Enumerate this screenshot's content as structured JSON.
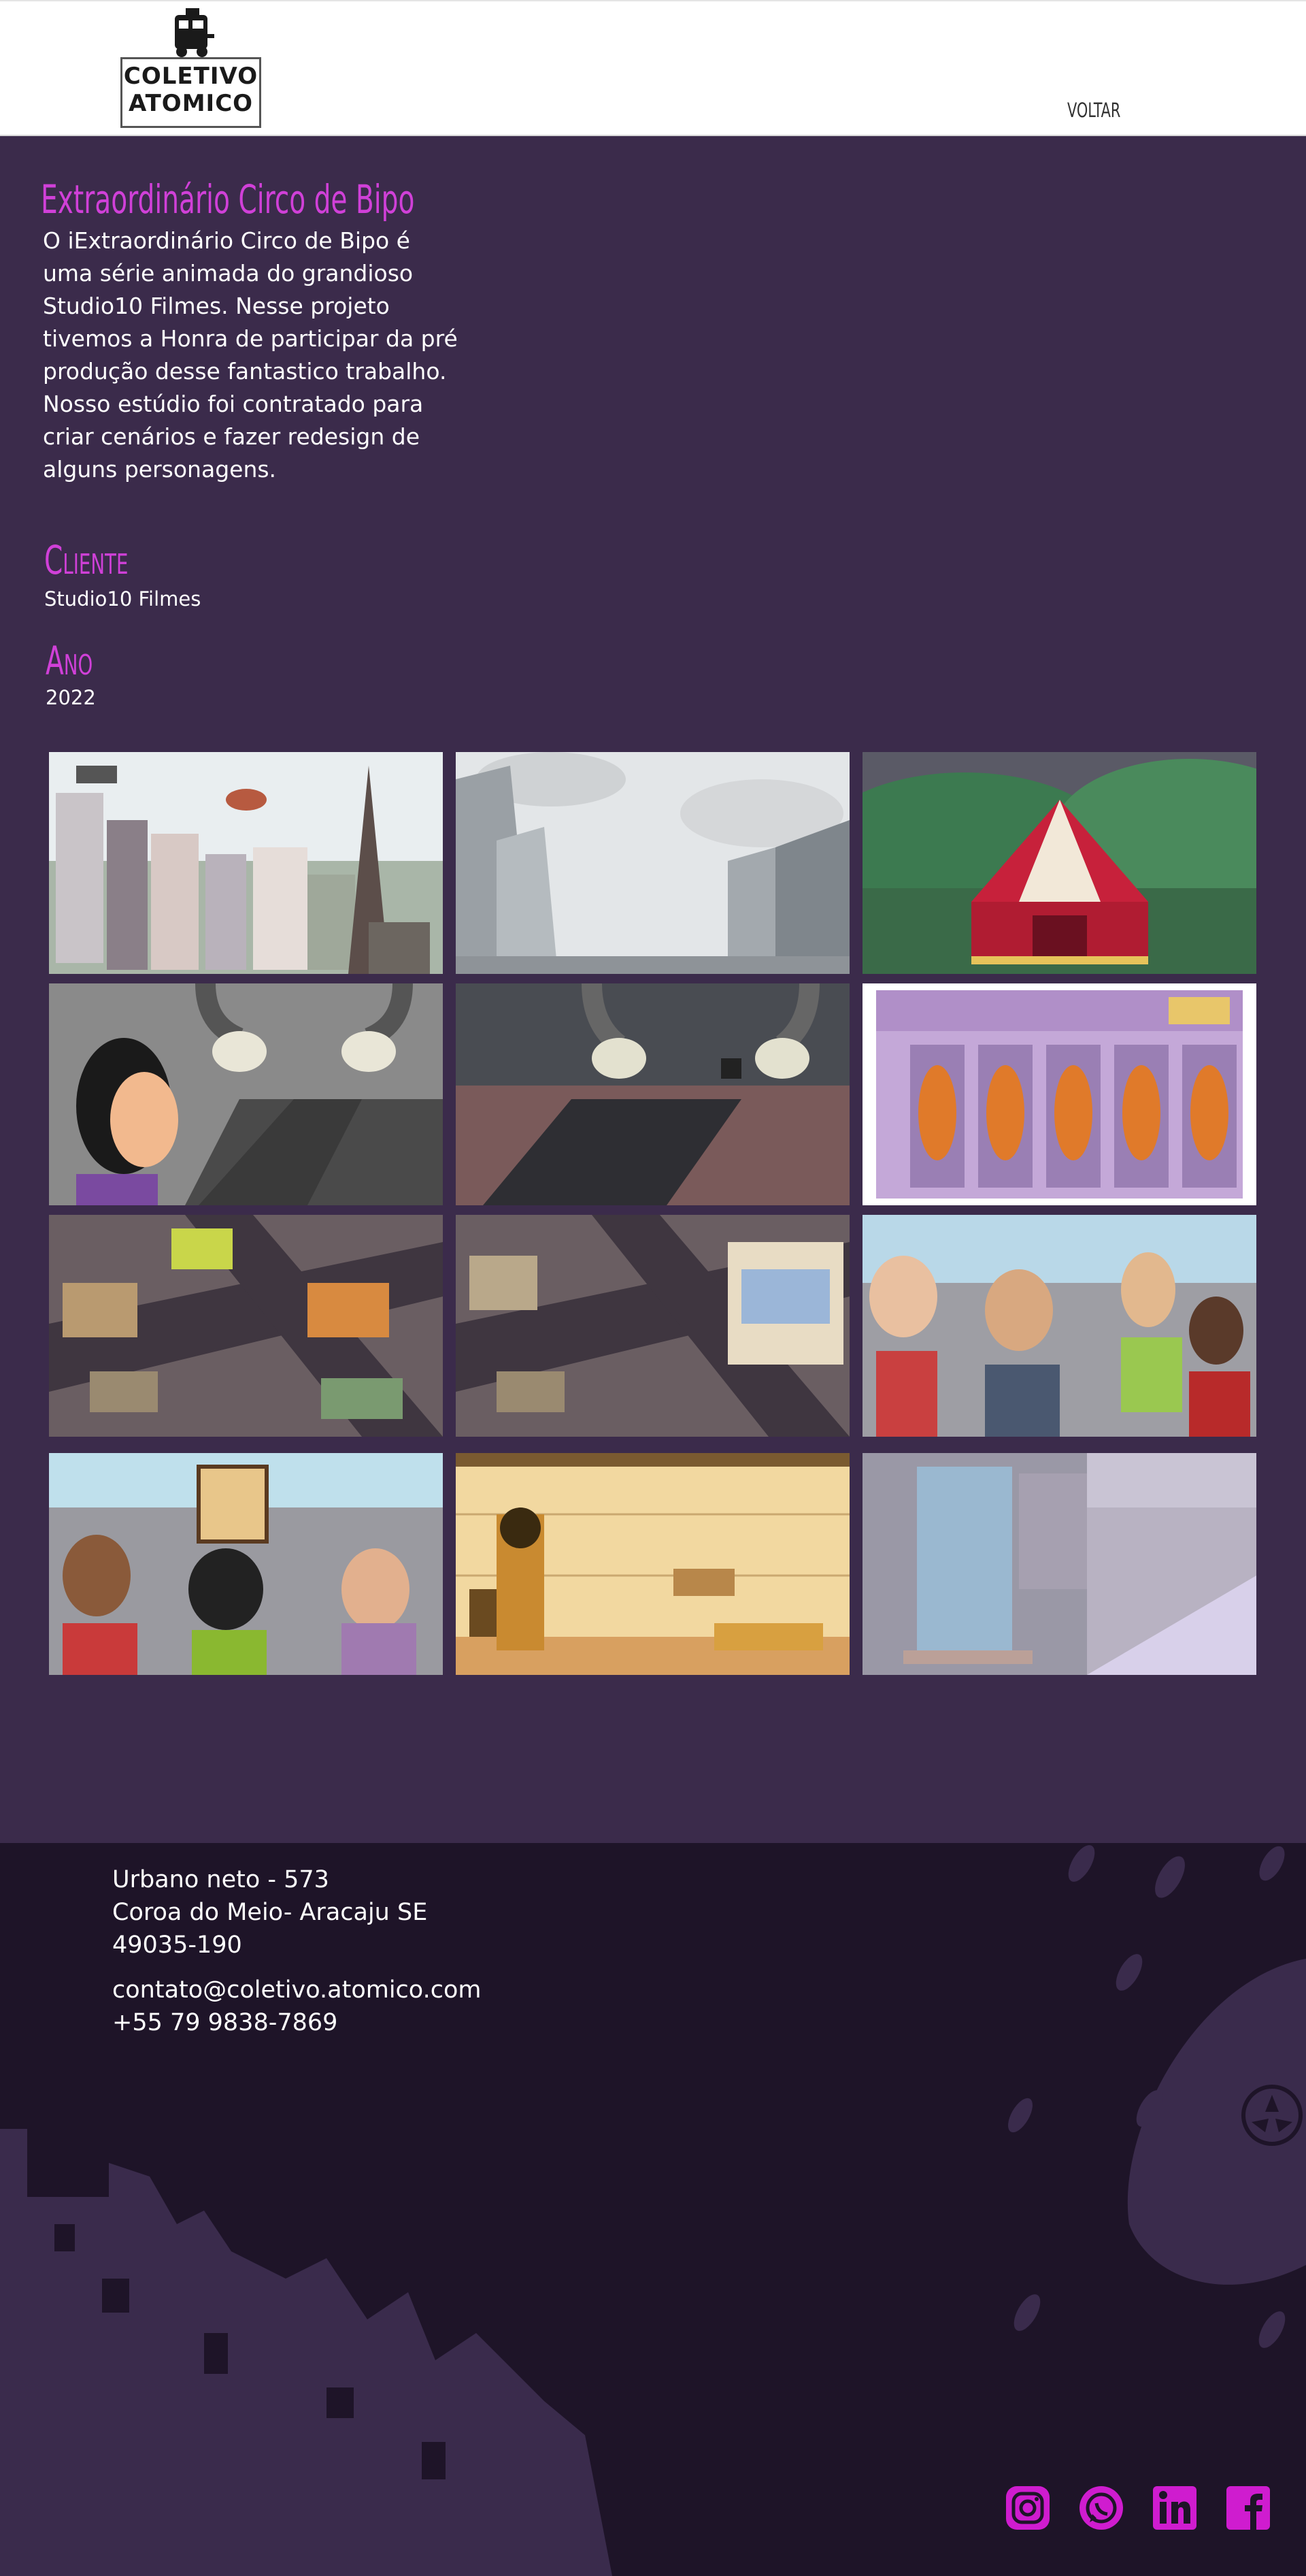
{
  "header": {
    "logo_text": "COLETIVO ATOMICO",
    "back_label": "VOLTAR"
  },
  "project": {
    "title": "Extraordinário Circo de Bipo",
    "description": [
      "O iExtraordinário Circo de Bipo é uma série animada do grandioso Studio10 Filmes. Nesse projeto tivemos a Honra de participar da pré produção desse fantastico trabalho.",
      "Nosso estúdio foi contratado para criar cenários e fazer redesign de alguns personagens."
    ],
    "client_label": "Cliente",
    "client_value": "Studio10 Filmes",
    "year_label": "Ano",
    "year_value": "2022"
  },
  "gallery": {
    "images": [
      "city-antenna-scene",
      "skyscrapers-clouds-scene",
      "circus-tent-scene",
      "character-robot-arms-sketch",
      "robot-arms-conveyor-scene",
      "capsule-machine-scene",
      "city-crossroads-scene",
      "city-crossroads-buildings-scene",
      "cheering-crowd-scene",
      "protest-crowd-sign-scene",
      "egyptian-tomb-scene",
      "building-entrance-street-scene"
    ]
  },
  "footer": {
    "address_lines": [
      "Urbano neto - 573",
      "Coroa do Meio- Aracaju SE",
      "49035-190"
    ],
    "email": "contato@coletivo.atomico.com",
    "phone": "+55 79 9838-7869",
    "social": [
      "instagram-icon",
      "whatsapp-icon",
      "linkedin-icon",
      "facebook-icon"
    ]
  },
  "colors": {
    "page_bg": "#3b2b4b",
    "footer_bg": "#1e1428",
    "accent": "#d040d8",
    "social_icon": "#cf1ccf"
  }
}
